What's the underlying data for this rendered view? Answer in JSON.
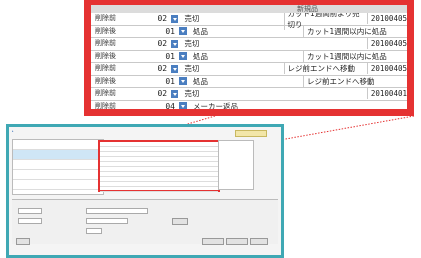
{
  "zoom_table": {
    "header": "新規品",
    "rows": [
      {
        "state": "削除前",
        "num": "02",
        "type": "売切",
        "note": "カット1週間前より売切り",
        "date": "20100405"
      },
      {
        "state": "削除後",
        "num": "01",
        "type": "処品",
        "note": "カット1週間以内に処品",
        "date": ""
      },
      {
        "state": "削除前",
        "num": "02",
        "type": "売切",
        "note": "",
        "date": "20100405"
      },
      {
        "state": "削除後",
        "num": "01",
        "type": "処品",
        "note": "カット1週間以内に処品",
        "date": ""
      },
      {
        "state": "削除前",
        "num": "02",
        "type": "売切",
        "note": "レジ前エンドへ移動",
        "date": "20100405"
      },
      {
        "state": "削除後",
        "num": "01",
        "type": "処品",
        "note": "レジ前エンドへ移動",
        "date": ""
      },
      {
        "state": "削除前",
        "num": "02",
        "type": "売切",
        "note": "",
        "date": "20100401"
      },
      {
        "state": "削除前",
        "num": "04",
        "type": "メーカー返品",
        "note": "",
        "date": ""
      }
    ]
  },
  "colors": {
    "highlight": "#e53232",
    "window_frame": "#3fa8b4",
    "dropdown": "#4a7ec0"
  }
}
